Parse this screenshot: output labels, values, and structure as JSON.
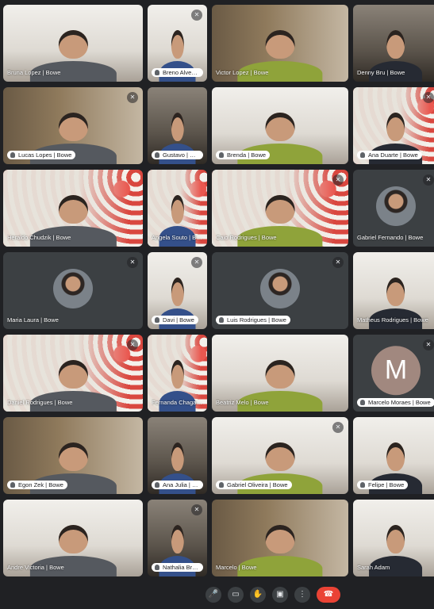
{
  "colors": {
    "background": "#202124",
    "tile": "#3c4043",
    "hangup": "#ea4335",
    "avatar_m": "#a1887f"
  },
  "participants": [
    {
      "name": "Bruna Lopez | Bowe",
      "kind": "video",
      "bg": "light"
    },
    {
      "name": "Breno Alves | Bowe",
      "kind": "video",
      "bg": "light",
      "chip": true
    },
    {
      "name": "Victor Lopez | Bowe",
      "kind": "video",
      "bg": "shelf"
    },
    {
      "name": "Denny Bru | Bowe",
      "kind": "video",
      "bg": "dark"
    },
    {
      "name": "Lucas Lopes | Bowe",
      "kind": "video",
      "bg": "shelf",
      "chip": true
    },
    {
      "name": "Gustavo | Bowe",
      "kind": "video",
      "bg": "dark",
      "chip": true
    },
    {
      "name": "Brenda | Bowe",
      "kind": "video",
      "bg": "light",
      "chip": true
    },
    {
      "name": "Ana Duarte | Bowe",
      "kind": "video",
      "bg": "studio",
      "chip": true
    },
    {
      "name": "Heraldo Chudzik | Bowe",
      "kind": "video",
      "bg": "studio"
    },
    {
      "name": "Angela Souto | Bowe",
      "kind": "video",
      "bg": "studio"
    },
    {
      "name": "Caio Rodrigues | Bowe",
      "kind": "video",
      "bg": "studio"
    },
    {
      "name": "Gabriel Fernando | Bowe",
      "kind": "avatar"
    },
    {
      "name": "Maria Laura | Bowe",
      "kind": "avatar"
    },
    {
      "name": "Davi | Bowe",
      "kind": "video",
      "bg": "light",
      "chip": true
    },
    {
      "name": "Luis Rodrigues | Bowe",
      "kind": "avatar",
      "chip": true
    },
    {
      "name": "Matheus Rodrigues | Bowe",
      "kind": "video",
      "bg": "light"
    },
    {
      "name": "Daniel Rodrigues | Bowe",
      "kind": "video",
      "bg": "studio"
    },
    {
      "name": "Fernanda Chagas | Bowe",
      "kind": "video",
      "bg": "studio"
    },
    {
      "name": "Beatriz Melo | Bowe",
      "kind": "video",
      "bg": "light"
    },
    {
      "name": "Marcelo Moraes | Bowe",
      "kind": "letter",
      "letter": "M",
      "chip": true
    },
    {
      "name": "Egon Zek | Bowe",
      "kind": "video",
      "bg": "shelf",
      "chip": true
    },
    {
      "name": "Ana Julia | Bowe",
      "kind": "video",
      "bg": "dark",
      "chip": true
    },
    {
      "name": "Gabriel Oliveira | Bowe",
      "kind": "video",
      "bg": "light",
      "chip": true
    },
    {
      "name": "Felipe | Bowe",
      "kind": "video",
      "bg": "light",
      "chip": true
    },
    {
      "name": "Andre Victoria | Bowe",
      "kind": "video",
      "bg": "light"
    },
    {
      "name": "Nathalia Braga | Bowe",
      "kind": "video",
      "bg": "dark",
      "chip": true
    },
    {
      "name": "Marcelo | Bowe",
      "kind": "video",
      "bg": "shelf"
    },
    {
      "name": "Sarah Adam",
      "kind": "video",
      "bg": "light"
    }
  ],
  "toolbar": [
    {
      "name": "mic-button",
      "icon": "mic-icon",
      "glyph": "🎤"
    },
    {
      "name": "camera-button",
      "icon": "camera-icon",
      "glyph": "▭"
    },
    {
      "name": "raise-hand-button",
      "icon": "hand-icon",
      "glyph": "✋"
    },
    {
      "name": "present-button",
      "icon": "present-icon",
      "glyph": "▣"
    },
    {
      "name": "more-options-button",
      "icon": "more-vert-icon",
      "glyph": "⋮"
    },
    {
      "name": "leave-call-button",
      "icon": "hangup-icon",
      "glyph": "☎",
      "hangup": true
    }
  ]
}
